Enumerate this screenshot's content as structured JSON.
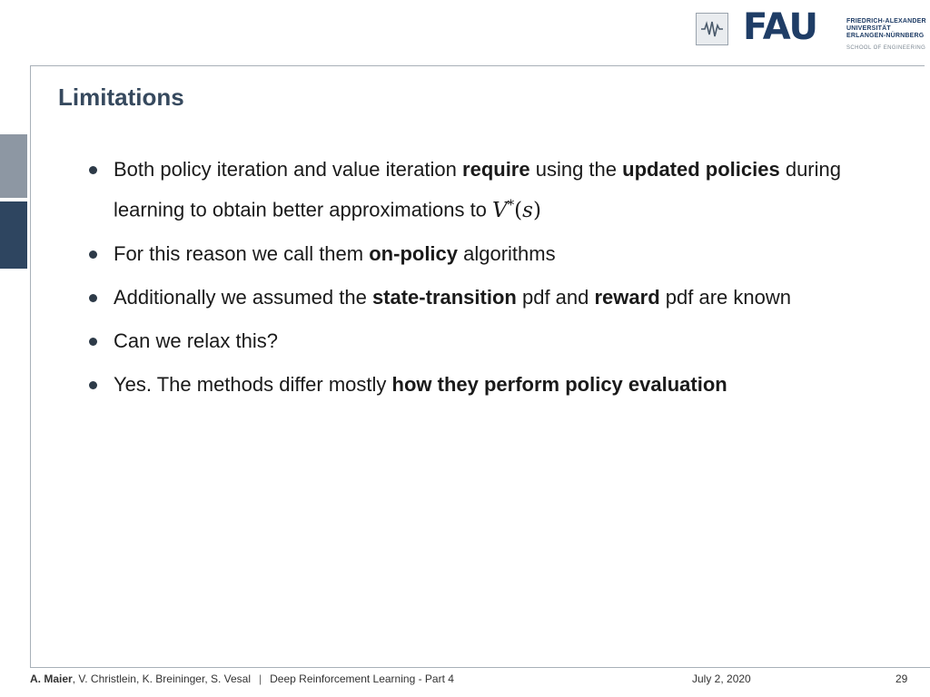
{
  "header": {
    "logo_icon": "fau-wave-emblem-icon",
    "logo_letters": "FAU",
    "university_lines": [
      "FRIEDRICH-ALEXANDER",
      "UNIVERSITÄT",
      "ERLANGEN-NÜRNBERG"
    ],
    "school": "SCHOOL OF ENGINEERING"
  },
  "slide": {
    "title": "Limitations",
    "bullets": [
      {
        "parts": [
          {
            "text": "Both policy iteration and value iteration ",
            "bold": false
          },
          {
            "text": "require",
            "bold": true
          },
          {
            "text": " using the ",
            "bold": false
          },
          {
            "text": "updated policies",
            "bold": true
          },
          {
            "text": " during learning to obtain better approximations to ",
            "bold": false
          }
        ],
        "math": {
          "sym": "V",
          "sup": "*",
          "open": "(",
          "arg": "s",
          "close": ")"
        }
      },
      {
        "parts": [
          {
            "text": "For this reason we call them ",
            "bold": false
          },
          {
            "text": "on-policy",
            "bold": true
          },
          {
            "text": " algorithms",
            "bold": false
          }
        ]
      },
      {
        "parts": [
          {
            "text": "Additionally we assumed the ",
            "bold": false
          },
          {
            "text": "state-transition",
            "bold": true
          },
          {
            "text": " pdf and ",
            "bold": false
          },
          {
            "text": "reward",
            "bold": true
          },
          {
            "text": " pdf are known",
            "bold": false
          }
        ]
      },
      {
        "parts": [
          {
            "text": "Can we relax this?",
            "bold": false
          }
        ]
      },
      {
        "parts": [
          {
            "text": "Yes. The methods differ mostly ",
            "bold": false
          },
          {
            "text": "how they perform policy evaluation",
            "bold": true
          }
        ]
      }
    ]
  },
  "footer": {
    "first_author": "A. Maier",
    "other_authors": ", V. Christlein, K. Breininger, S. Vesal",
    "separator": "|",
    "lecture": "Deep Reinforcement Learning - Part 4",
    "date": "July 2, 2020",
    "page": "29"
  },
  "colors": {
    "title": "#36495e",
    "brand_blue": "#1f3d66",
    "side_tab_light": "#8d97a3",
    "side_tab_dark": "#2e4560",
    "frame": "#a8b0b8"
  }
}
